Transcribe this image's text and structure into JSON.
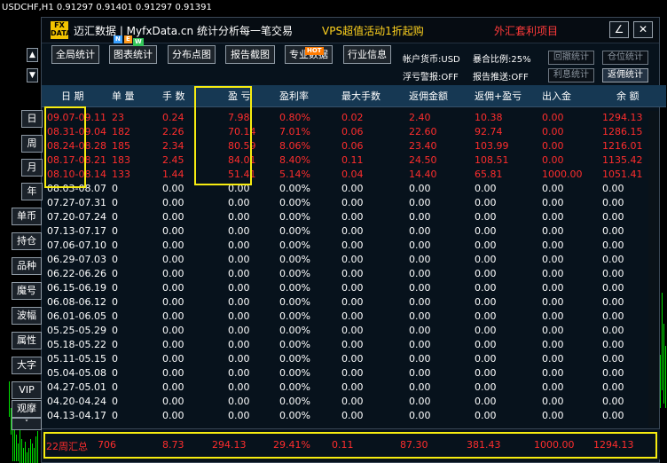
{
  "chart": {
    "title": "USDCHF,H1  0.91297 0.91401 0.91297 0.91391"
  },
  "header": {
    "logo": "FX DATA",
    "brand": "迈汇数据 | MyfxData.cn  统计分析每一笔交易",
    "promo": "VPS超值活动1折起购",
    "promo2": "外汇套利项目",
    "edit_icon": "pencil-icon",
    "close_icon": "close-icon"
  },
  "toolbar": {
    "buttons": [
      {
        "label": "全局统计"
      },
      {
        "label": "图表统计",
        "badges": [
          "N",
          "E",
          "W"
        ]
      },
      {
        "label": "分布点图"
      },
      {
        "label": "报告截图"
      },
      {
        "label": "专业数据",
        "badge": "HOT"
      },
      {
        "label": "行业信息"
      }
    ]
  },
  "account": {
    "currency": "帐户货币:USD",
    "exposure": "暴合比例:25%",
    "float_alert": "浮亏警报:OFF",
    "report_push": "报告推送:OFF",
    "btn_return_stats": "回撤统计",
    "btn_position_stats": "仓位统计",
    "btn_interest_stats": "利息统计",
    "btn_rebate_stats": "返佣统计"
  },
  "sidebar": {
    "up_icon": "arrow-up-icon",
    "down_icon": "arrow-down-icon",
    "period_buttons": [
      "日",
      "周",
      "月",
      "年"
    ],
    "feature_buttons": [
      "单币",
      "持仓",
      "品种",
      "魔号",
      "波幅",
      "属性",
      "大字",
      "VIP",
      "观摩"
    ],
    "more_icon": "chevron-down-icon"
  },
  "table": {
    "columns": [
      "日 期",
      "单 量",
      "手 数",
      "盈 亏",
      "盈利率",
      "最大手数",
      "返佣金额",
      "返佣+盈亏",
      "出入金",
      "余 额"
    ],
    "rows": [
      {
        "date": "09.07-09.11",
        "orders": "23",
        "lots": "0.24",
        "pnl": "7.98",
        "rate": "0.80%",
        "max_lots": "0.02",
        "rebate": "2.40",
        "rebate_pnl": "10.38",
        "flow": "0.00",
        "balance": "1294.13"
      },
      {
        "date": "08.31-09.04",
        "orders": "182",
        "lots": "2.26",
        "pnl": "70.14",
        "rate": "7.01%",
        "max_lots": "0.06",
        "rebate": "22.60",
        "rebate_pnl": "92.74",
        "flow": "0.00",
        "balance": "1286.15"
      },
      {
        "date": "08.24-08.28",
        "orders": "185",
        "lots": "2.34",
        "pnl": "80.59",
        "rate": "8.06%",
        "max_lots": "0.06",
        "rebate": "23.40",
        "rebate_pnl": "103.99",
        "flow": "0.00",
        "balance": "1216.01"
      },
      {
        "date": "08.17-08.21",
        "orders": "183",
        "lots": "2.45",
        "pnl": "84.01",
        "rate": "8.40%",
        "max_lots": "0.11",
        "rebate": "24.50",
        "rebate_pnl": "108.51",
        "flow": "0.00",
        "balance": "1135.42"
      },
      {
        "date": "08.10-08.14",
        "orders": "133",
        "lots": "1.44",
        "pnl": "51.41",
        "rate": "5.14%",
        "max_lots": "0.04",
        "rebate": "14.40",
        "rebate_pnl": "65.81",
        "flow": "1000.00",
        "balance": "1051.41"
      },
      {
        "date": "08.03-08.07",
        "orders": "0",
        "lots": "0.00",
        "pnl": "0.00",
        "rate": "0.00%",
        "max_lots": "0.00",
        "rebate": "0.00",
        "rebate_pnl": "0.00",
        "flow": "0.00",
        "balance": "0.00"
      },
      {
        "date": "07.27-07.31",
        "orders": "0",
        "lots": "0.00",
        "pnl": "0.00",
        "rate": "0.00%",
        "max_lots": "0.00",
        "rebate": "0.00",
        "rebate_pnl": "0.00",
        "flow": "0.00",
        "balance": "0.00"
      },
      {
        "date": "07.20-07.24",
        "orders": "0",
        "lots": "0.00",
        "pnl": "0.00",
        "rate": "0.00%",
        "max_lots": "0.00",
        "rebate": "0.00",
        "rebate_pnl": "0.00",
        "flow": "0.00",
        "balance": "0.00"
      },
      {
        "date": "07.13-07.17",
        "orders": "0",
        "lots": "0.00",
        "pnl": "0.00",
        "rate": "0.00%",
        "max_lots": "0.00",
        "rebate": "0.00",
        "rebate_pnl": "0.00",
        "flow": "0.00",
        "balance": "0.00"
      },
      {
        "date": "07.06-07.10",
        "orders": "0",
        "lots": "0.00",
        "pnl": "0.00",
        "rate": "0.00%",
        "max_lots": "0.00",
        "rebate": "0.00",
        "rebate_pnl": "0.00",
        "flow": "0.00",
        "balance": "0.00"
      },
      {
        "date": "06.29-07.03",
        "orders": "0",
        "lots": "0.00",
        "pnl": "0.00",
        "rate": "0.00%",
        "max_lots": "0.00",
        "rebate": "0.00",
        "rebate_pnl": "0.00",
        "flow": "0.00",
        "balance": "0.00"
      },
      {
        "date": "06.22-06.26",
        "orders": "0",
        "lots": "0.00",
        "pnl": "0.00",
        "rate": "0.00%",
        "max_lots": "0.00",
        "rebate": "0.00",
        "rebate_pnl": "0.00",
        "flow": "0.00",
        "balance": "0.00"
      },
      {
        "date": "06.15-06.19",
        "orders": "0",
        "lots": "0.00",
        "pnl": "0.00",
        "rate": "0.00%",
        "max_lots": "0.00",
        "rebate": "0.00",
        "rebate_pnl": "0.00",
        "flow": "0.00",
        "balance": "0.00"
      },
      {
        "date": "06.08-06.12",
        "orders": "0",
        "lots": "0.00",
        "pnl": "0.00",
        "rate": "0.00%",
        "max_lots": "0.00",
        "rebate": "0.00",
        "rebate_pnl": "0.00",
        "flow": "0.00",
        "balance": "0.00"
      },
      {
        "date": "06.01-06.05",
        "orders": "0",
        "lots": "0.00",
        "pnl": "0.00",
        "rate": "0.00%",
        "max_lots": "0.00",
        "rebate": "0.00",
        "rebate_pnl": "0.00",
        "flow": "0.00",
        "balance": "0.00"
      },
      {
        "date": "05.25-05.29",
        "orders": "0",
        "lots": "0.00",
        "pnl": "0.00",
        "rate": "0.00%",
        "max_lots": "0.00",
        "rebate": "0.00",
        "rebate_pnl": "0.00",
        "flow": "0.00",
        "balance": "0.00"
      },
      {
        "date": "05.18-05.22",
        "orders": "0",
        "lots": "0.00",
        "pnl": "0.00",
        "rate": "0.00%",
        "max_lots": "0.00",
        "rebate": "0.00",
        "rebate_pnl": "0.00",
        "flow": "0.00",
        "balance": "0.00"
      },
      {
        "date": "05.11-05.15",
        "orders": "0",
        "lots": "0.00",
        "pnl": "0.00",
        "rate": "0.00%",
        "max_lots": "0.00",
        "rebate": "0.00",
        "rebate_pnl": "0.00",
        "flow": "0.00",
        "balance": "0.00"
      },
      {
        "date": "05.04-05.08",
        "orders": "0",
        "lots": "0.00",
        "pnl": "0.00",
        "rate": "0.00%",
        "max_lots": "0.00",
        "rebate": "0.00",
        "rebate_pnl": "0.00",
        "flow": "0.00",
        "balance": "0.00"
      },
      {
        "date": "04.27-05.01",
        "orders": "0",
        "lots": "0.00",
        "pnl": "0.00",
        "rate": "0.00%",
        "max_lots": "0.00",
        "rebate": "0.00",
        "rebate_pnl": "0.00",
        "flow": "0.00",
        "balance": "0.00"
      },
      {
        "date": "04.20-04.24",
        "orders": "0",
        "lots": "0.00",
        "pnl": "0.00",
        "rate": "0.00%",
        "max_lots": "0.00",
        "rebate": "0.00",
        "rebate_pnl": "0.00",
        "flow": "0.00",
        "balance": "0.00"
      },
      {
        "date": "04.13-04.17",
        "orders": "0",
        "lots": "0.00",
        "pnl": "0.00",
        "rate": "0.00%",
        "max_lots": "0.00",
        "rebate": "0.00",
        "rebate_pnl": "0.00",
        "flow": "0.00",
        "balance": "0.00"
      }
    ],
    "highlight_rows": 5
  },
  "summary": {
    "label": "22周汇总",
    "orders": "706",
    "lots": "8.73",
    "pnl": "294.13",
    "rate": "29.41%",
    "max_lots": "0.11",
    "rebate": "87.30",
    "rebate_pnl": "381.43",
    "flow": "1000.00",
    "balance": "1294.13"
  },
  "colors": {
    "profit_red": "#ff2d2d",
    "header_bar": "#163853",
    "highlight_yellow": "#f7ec10",
    "promo_yellow": "#ffd21e"
  }
}
